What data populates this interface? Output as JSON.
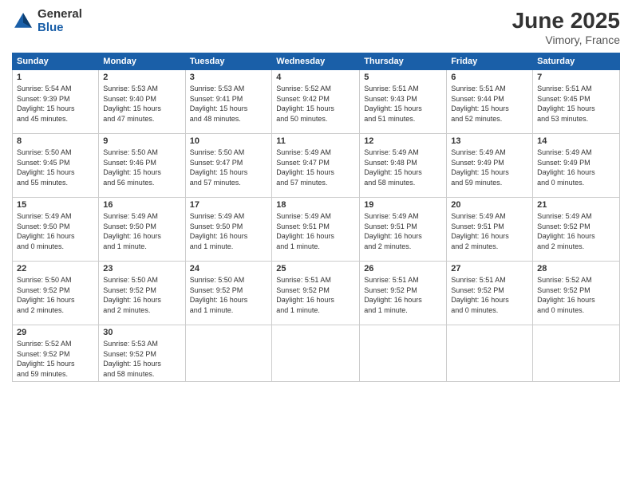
{
  "logo": {
    "general": "General",
    "blue": "Blue"
  },
  "title": "June 2025",
  "location": "Vimory, France",
  "headers": [
    "Sunday",
    "Monday",
    "Tuesday",
    "Wednesday",
    "Thursday",
    "Friday",
    "Saturday"
  ],
  "weeks": [
    [
      {
        "day": "1",
        "info": "Sunrise: 5:54 AM\nSunset: 9:39 PM\nDaylight: 15 hours\nand 45 minutes."
      },
      {
        "day": "2",
        "info": "Sunrise: 5:53 AM\nSunset: 9:40 PM\nDaylight: 15 hours\nand 47 minutes."
      },
      {
        "day": "3",
        "info": "Sunrise: 5:53 AM\nSunset: 9:41 PM\nDaylight: 15 hours\nand 48 minutes."
      },
      {
        "day": "4",
        "info": "Sunrise: 5:52 AM\nSunset: 9:42 PM\nDaylight: 15 hours\nand 50 minutes."
      },
      {
        "day": "5",
        "info": "Sunrise: 5:51 AM\nSunset: 9:43 PM\nDaylight: 15 hours\nand 51 minutes."
      },
      {
        "day": "6",
        "info": "Sunrise: 5:51 AM\nSunset: 9:44 PM\nDaylight: 15 hours\nand 52 minutes."
      },
      {
        "day": "7",
        "info": "Sunrise: 5:51 AM\nSunset: 9:45 PM\nDaylight: 15 hours\nand 53 minutes."
      }
    ],
    [
      {
        "day": "8",
        "info": "Sunrise: 5:50 AM\nSunset: 9:45 PM\nDaylight: 15 hours\nand 55 minutes."
      },
      {
        "day": "9",
        "info": "Sunrise: 5:50 AM\nSunset: 9:46 PM\nDaylight: 15 hours\nand 56 minutes."
      },
      {
        "day": "10",
        "info": "Sunrise: 5:50 AM\nSunset: 9:47 PM\nDaylight: 15 hours\nand 57 minutes."
      },
      {
        "day": "11",
        "info": "Sunrise: 5:49 AM\nSunset: 9:47 PM\nDaylight: 15 hours\nand 57 minutes."
      },
      {
        "day": "12",
        "info": "Sunrise: 5:49 AM\nSunset: 9:48 PM\nDaylight: 15 hours\nand 58 minutes."
      },
      {
        "day": "13",
        "info": "Sunrise: 5:49 AM\nSunset: 9:49 PM\nDaylight: 15 hours\nand 59 minutes."
      },
      {
        "day": "14",
        "info": "Sunrise: 5:49 AM\nSunset: 9:49 PM\nDaylight: 16 hours\nand 0 minutes."
      }
    ],
    [
      {
        "day": "15",
        "info": "Sunrise: 5:49 AM\nSunset: 9:50 PM\nDaylight: 16 hours\nand 0 minutes."
      },
      {
        "day": "16",
        "info": "Sunrise: 5:49 AM\nSunset: 9:50 PM\nDaylight: 16 hours\nand 1 minute."
      },
      {
        "day": "17",
        "info": "Sunrise: 5:49 AM\nSunset: 9:50 PM\nDaylight: 16 hours\nand 1 minute."
      },
      {
        "day": "18",
        "info": "Sunrise: 5:49 AM\nSunset: 9:51 PM\nDaylight: 16 hours\nand 1 minute."
      },
      {
        "day": "19",
        "info": "Sunrise: 5:49 AM\nSunset: 9:51 PM\nDaylight: 16 hours\nand 2 minutes."
      },
      {
        "day": "20",
        "info": "Sunrise: 5:49 AM\nSunset: 9:51 PM\nDaylight: 16 hours\nand 2 minutes."
      },
      {
        "day": "21",
        "info": "Sunrise: 5:49 AM\nSunset: 9:52 PM\nDaylight: 16 hours\nand 2 minutes."
      }
    ],
    [
      {
        "day": "22",
        "info": "Sunrise: 5:50 AM\nSunset: 9:52 PM\nDaylight: 16 hours\nand 2 minutes."
      },
      {
        "day": "23",
        "info": "Sunrise: 5:50 AM\nSunset: 9:52 PM\nDaylight: 16 hours\nand 2 minutes."
      },
      {
        "day": "24",
        "info": "Sunrise: 5:50 AM\nSunset: 9:52 PM\nDaylight: 16 hours\nand 1 minute."
      },
      {
        "day": "25",
        "info": "Sunrise: 5:51 AM\nSunset: 9:52 PM\nDaylight: 16 hours\nand 1 minute."
      },
      {
        "day": "26",
        "info": "Sunrise: 5:51 AM\nSunset: 9:52 PM\nDaylight: 16 hours\nand 1 minute."
      },
      {
        "day": "27",
        "info": "Sunrise: 5:51 AM\nSunset: 9:52 PM\nDaylight: 16 hours\nand 0 minutes."
      },
      {
        "day": "28",
        "info": "Sunrise: 5:52 AM\nSunset: 9:52 PM\nDaylight: 16 hours\nand 0 minutes."
      }
    ],
    [
      {
        "day": "29",
        "info": "Sunrise: 5:52 AM\nSunset: 9:52 PM\nDaylight: 15 hours\nand 59 minutes."
      },
      {
        "day": "30",
        "info": "Sunrise: 5:53 AM\nSunset: 9:52 PM\nDaylight: 15 hours\nand 58 minutes."
      },
      {
        "day": "",
        "info": ""
      },
      {
        "day": "",
        "info": ""
      },
      {
        "day": "",
        "info": ""
      },
      {
        "day": "",
        "info": ""
      },
      {
        "day": "",
        "info": ""
      }
    ]
  ]
}
